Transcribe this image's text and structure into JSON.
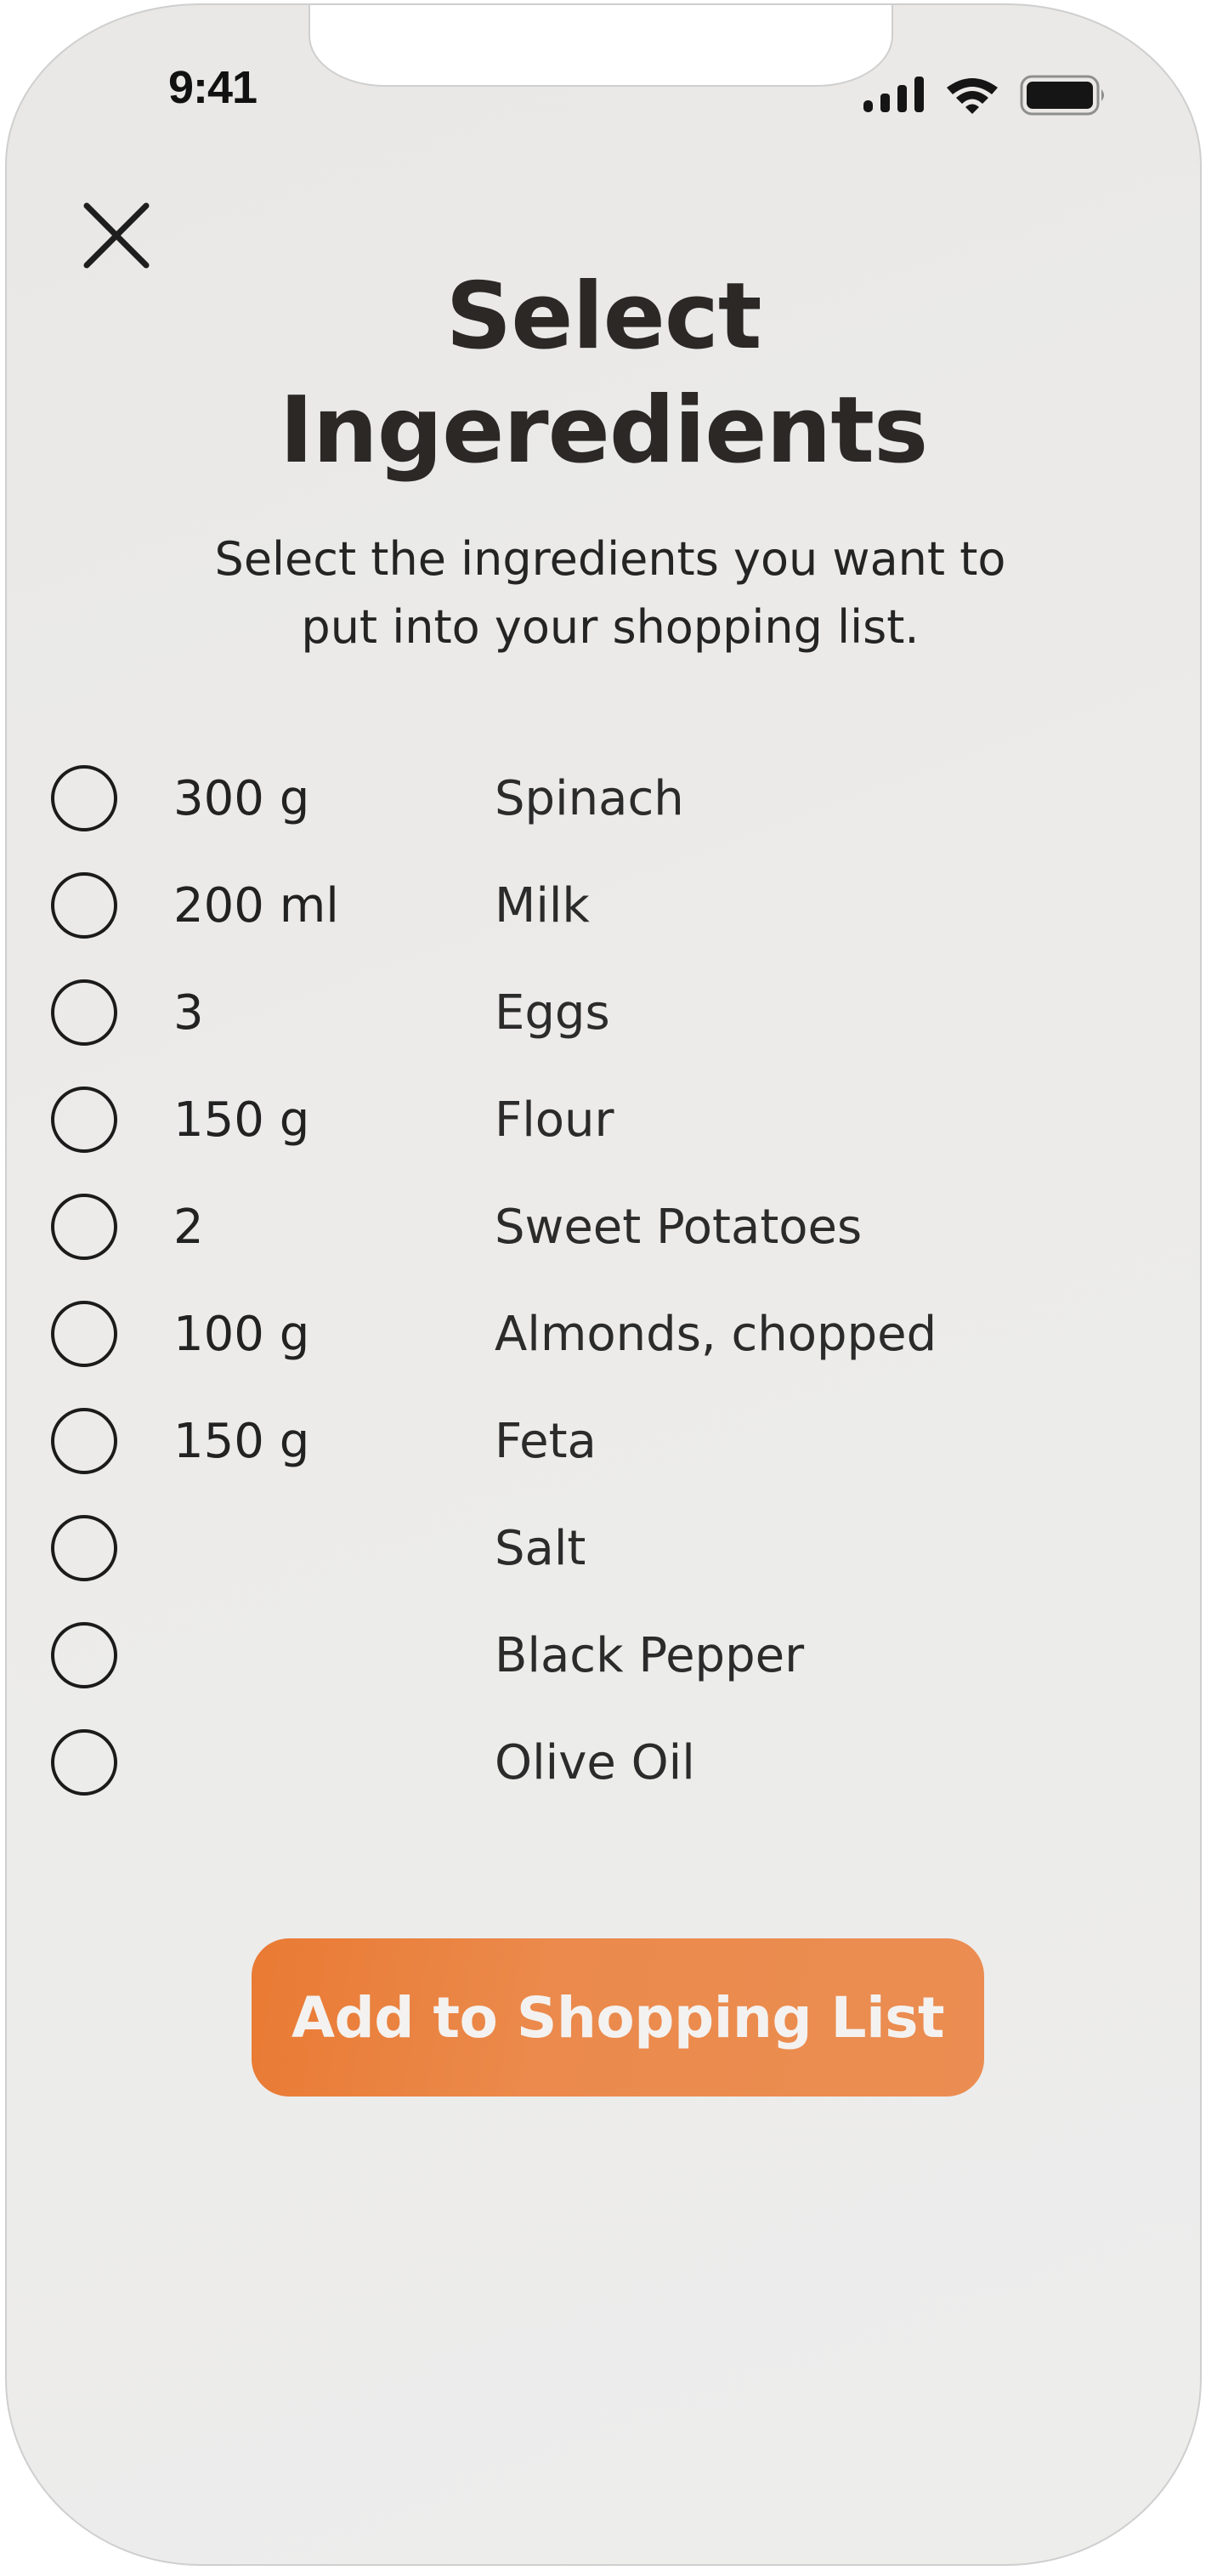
{
  "status_bar": {
    "time": "9:41",
    "icons": [
      "cellular-signal-icon",
      "wifi-icon",
      "battery-icon"
    ]
  },
  "header": {
    "close_icon": "close-icon",
    "title_line1": "Select",
    "title_line2": "Ingeredients",
    "subtitle_line1": "Select the ingredients you want to",
    "subtitle_line2": "put into your shopping list."
  },
  "ingredients": [
    {
      "quantity": "300 g",
      "name": "Spinach",
      "selected": false
    },
    {
      "quantity": "200 ml",
      "name": "Milk",
      "selected": false
    },
    {
      "quantity": "3",
      "name": "Eggs",
      "selected": false
    },
    {
      "quantity": "150 g",
      "name": "Flour",
      "selected": false
    },
    {
      "quantity": "2",
      "name": "Sweet Potatoes",
      "selected": false
    },
    {
      "quantity": "100 g",
      "name": "Almonds, chopped",
      "selected": false
    },
    {
      "quantity": "150 g",
      "name": "Feta",
      "selected": false
    },
    {
      "quantity": "",
      "name": "Salt",
      "selected": false
    },
    {
      "quantity": "",
      "name": "Black Pepper",
      "selected": false
    },
    {
      "quantity": "",
      "name": "Olive Oil",
      "selected": false
    }
  ],
  "actions": {
    "add_to_list_label": "Add to Shopping List"
  },
  "colors": {
    "accent": "#EB8A4C",
    "text": "#2B2826",
    "background": "#ECEBEA"
  }
}
